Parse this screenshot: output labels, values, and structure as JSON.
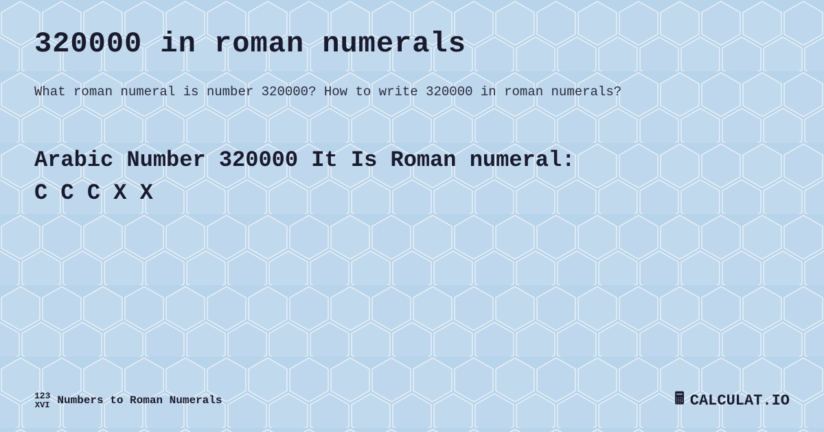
{
  "page": {
    "background_color": "#c8ddf0",
    "title": "320000 in roman numerals",
    "description": "What roman numeral is number 320000? How to write 320000 in roman numerals?",
    "result_line1": "Arabic Number 320000 It Is  Roman numeral:",
    "result_line2": "C C C X X",
    "footer": {
      "brand_left_top": "123",
      "brand_left_bottom": "XVI",
      "brand_label": "Numbers to Roman Numerals",
      "brand_right": "CALCULAT.IO"
    }
  }
}
